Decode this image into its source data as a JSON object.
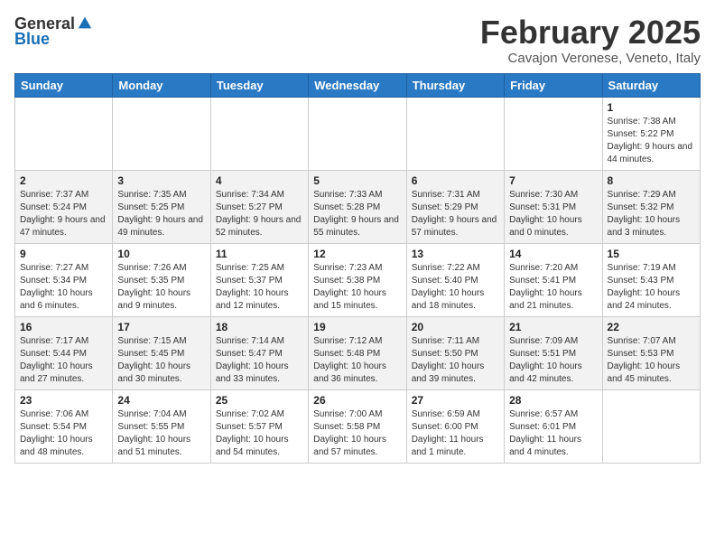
{
  "header": {
    "logo_general": "General",
    "logo_blue": "Blue",
    "month_year": "February 2025",
    "location": "Cavajon Veronese, Veneto, Italy"
  },
  "days_of_week": [
    "Sunday",
    "Monday",
    "Tuesday",
    "Wednesday",
    "Thursday",
    "Friday",
    "Saturday"
  ],
  "weeks": [
    [
      {
        "day": "",
        "info": ""
      },
      {
        "day": "",
        "info": ""
      },
      {
        "day": "",
        "info": ""
      },
      {
        "day": "",
        "info": ""
      },
      {
        "day": "",
        "info": ""
      },
      {
        "day": "",
        "info": ""
      },
      {
        "day": "1",
        "info": "Sunrise: 7:38 AM\nSunset: 5:22 PM\nDaylight: 9 hours and 44 minutes."
      }
    ],
    [
      {
        "day": "2",
        "info": "Sunrise: 7:37 AM\nSunset: 5:24 PM\nDaylight: 9 hours and 47 minutes."
      },
      {
        "day": "3",
        "info": "Sunrise: 7:35 AM\nSunset: 5:25 PM\nDaylight: 9 hours and 49 minutes."
      },
      {
        "day": "4",
        "info": "Sunrise: 7:34 AM\nSunset: 5:27 PM\nDaylight: 9 hours and 52 minutes."
      },
      {
        "day": "5",
        "info": "Sunrise: 7:33 AM\nSunset: 5:28 PM\nDaylight: 9 hours and 55 minutes."
      },
      {
        "day": "6",
        "info": "Sunrise: 7:31 AM\nSunset: 5:29 PM\nDaylight: 9 hours and 57 minutes."
      },
      {
        "day": "7",
        "info": "Sunrise: 7:30 AM\nSunset: 5:31 PM\nDaylight: 10 hours and 0 minutes."
      },
      {
        "day": "8",
        "info": "Sunrise: 7:29 AM\nSunset: 5:32 PM\nDaylight: 10 hours and 3 minutes."
      }
    ],
    [
      {
        "day": "9",
        "info": "Sunrise: 7:27 AM\nSunset: 5:34 PM\nDaylight: 10 hours and 6 minutes."
      },
      {
        "day": "10",
        "info": "Sunrise: 7:26 AM\nSunset: 5:35 PM\nDaylight: 10 hours and 9 minutes."
      },
      {
        "day": "11",
        "info": "Sunrise: 7:25 AM\nSunset: 5:37 PM\nDaylight: 10 hours and 12 minutes."
      },
      {
        "day": "12",
        "info": "Sunrise: 7:23 AM\nSunset: 5:38 PM\nDaylight: 10 hours and 15 minutes."
      },
      {
        "day": "13",
        "info": "Sunrise: 7:22 AM\nSunset: 5:40 PM\nDaylight: 10 hours and 18 minutes."
      },
      {
        "day": "14",
        "info": "Sunrise: 7:20 AM\nSunset: 5:41 PM\nDaylight: 10 hours and 21 minutes."
      },
      {
        "day": "15",
        "info": "Sunrise: 7:19 AM\nSunset: 5:43 PM\nDaylight: 10 hours and 24 minutes."
      }
    ],
    [
      {
        "day": "16",
        "info": "Sunrise: 7:17 AM\nSunset: 5:44 PM\nDaylight: 10 hours and 27 minutes."
      },
      {
        "day": "17",
        "info": "Sunrise: 7:15 AM\nSunset: 5:45 PM\nDaylight: 10 hours and 30 minutes."
      },
      {
        "day": "18",
        "info": "Sunrise: 7:14 AM\nSunset: 5:47 PM\nDaylight: 10 hours and 33 minutes."
      },
      {
        "day": "19",
        "info": "Sunrise: 7:12 AM\nSunset: 5:48 PM\nDaylight: 10 hours and 36 minutes."
      },
      {
        "day": "20",
        "info": "Sunrise: 7:11 AM\nSunset: 5:50 PM\nDaylight: 10 hours and 39 minutes."
      },
      {
        "day": "21",
        "info": "Sunrise: 7:09 AM\nSunset: 5:51 PM\nDaylight: 10 hours and 42 minutes."
      },
      {
        "day": "22",
        "info": "Sunrise: 7:07 AM\nSunset: 5:53 PM\nDaylight: 10 hours and 45 minutes."
      }
    ],
    [
      {
        "day": "23",
        "info": "Sunrise: 7:06 AM\nSunset: 5:54 PM\nDaylight: 10 hours and 48 minutes."
      },
      {
        "day": "24",
        "info": "Sunrise: 7:04 AM\nSunset: 5:55 PM\nDaylight: 10 hours and 51 minutes."
      },
      {
        "day": "25",
        "info": "Sunrise: 7:02 AM\nSunset: 5:57 PM\nDaylight: 10 hours and 54 minutes."
      },
      {
        "day": "26",
        "info": "Sunrise: 7:00 AM\nSunset: 5:58 PM\nDaylight: 10 hours and 57 minutes."
      },
      {
        "day": "27",
        "info": "Sunrise: 6:59 AM\nSunset: 6:00 PM\nDaylight: 11 hours and 1 minute."
      },
      {
        "day": "28",
        "info": "Sunrise: 6:57 AM\nSunset: 6:01 PM\nDaylight: 11 hours and 4 minutes."
      },
      {
        "day": "",
        "info": ""
      }
    ]
  ]
}
